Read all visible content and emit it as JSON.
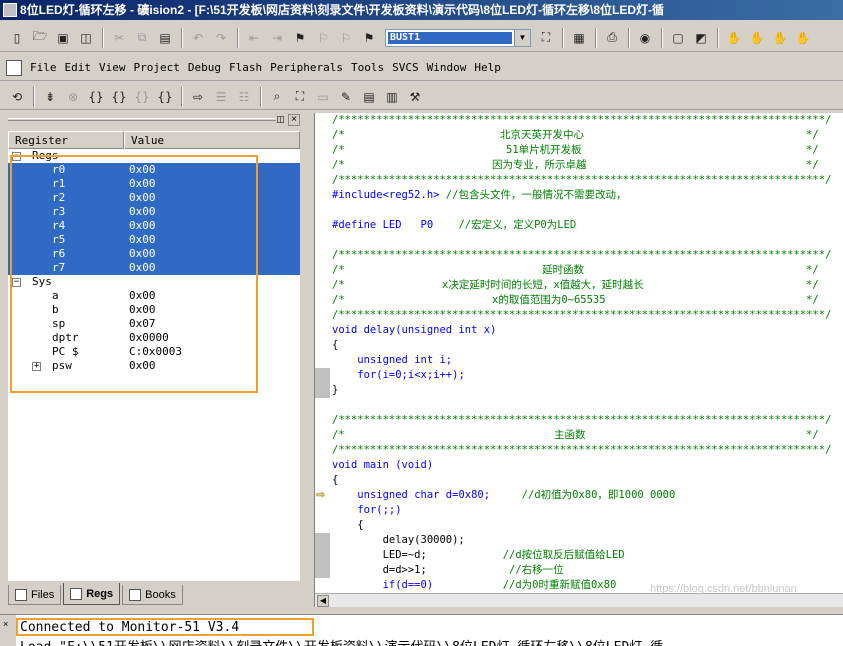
{
  "window": {
    "title": "8位LED灯-循环左移   - 礦ision2  - [F:\\51开发板\\网店资料\\刻录文件\\开发板资料\\演示代码\\8位LED灯-循环左移\\8位LED灯-循"
  },
  "toolbar": {
    "target_combo": "BUST1"
  },
  "menu": {
    "items": [
      "File",
      "Edit",
      "View",
      "Project",
      "Debug",
      "Flash",
      "Peripherals",
      "Tools",
      "SVCS",
      "Window",
      "Help"
    ]
  },
  "registers": {
    "header": {
      "col1": "Register",
      "col2": "Value"
    },
    "regs_label": "Regs",
    "regs": [
      {
        "name": "r0",
        "value": "0x00"
      },
      {
        "name": "r1",
        "value": "0x00"
      },
      {
        "name": "r2",
        "value": "0x00"
      },
      {
        "name": "r3",
        "value": "0x00"
      },
      {
        "name": "r4",
        "value": "0x00"
      },
      {
        "name": "r5",
        "value": "0x00"
      },
      {
        "name": "r6",
        "value": "0x00"
      },
      {
        "name": "r7",
        "value": "0x00"
      }
    ],
    "sys_label": "Sys",
    "sys": [
      {
        "name": "a",
        "value": "0x00"
      },
      {
        "name": "b",
        "value": "0x00"
      },
      {
        "name": "sp",
        "value": "0x07"
      },
      {
        "name": "dptr",
        "value": "0x0000"
      },
      {
        "name": "PC  $",
        "value": "C:0x0003"
      },
      {
        "name": "psw",
        "value": "0x00"
      }
    ],
    "expand_plus": "+",
    "expand_minus": "−"
  },
  "tabs": {
    "files": "Files",
    "regs": "Regs",
    "books": "Books"
  },
  "code": {
    "stars": "/*****************************************************************************/",
    "header_lines": [
      "北京天英开发中心",
      "51单片机开发板",
      "因为专业，所示卓越"
    ],
    "include_code": "#include<reg52.h>",
    "include_comment": "//包含头文件，一般情况不需要改动，",
    "define_code": "#define LED   P0",
    "define_comment": "//宏定义，定义P0为LED",
    "delay_header": [
      "延时函数",
      "x决定延时时间的长短，x值越大，延时越长",
      "x的取值范围为0~65535"
    ],
    "delay_sig": "void delay(unsigned int x)",
    "brace_open": "{",
    "brace_close": "}",
    "delay_decl": "unsigned int i;",
    "delay_loop": "for(i=0;i<x;i++);",
    "main_header": "主函数",
    "main_sig": "void main (void)",
    "main_decl": "unsigned char d=0x80;",
    "main_decl_comment": "//d初值为0x80，即1000 0000",
    "for_loop": "for(;;)",
    "inner_brace": "{",
    "delay_call": "delay(30000);",
    "led_assign": "LED=~d;",
    "led_comment": "//d按位取反后赋值给LED",
    "shift": "d=d>>1;",
    "shift_comment": "//右移一位",
    "if_stmt": "if(d==0)",
    "if_comment": "//d为0时重新赋值0x80",
    "comment_open": "/*",
    "comment_close": "*/"
  },
  "watermark": "https://blog.csdn.net/bbnlunan",
  "output": {
    "line1": "Connected to Monitor-51 V3.4",
    "line2": "Load \"F:\\\\51开发板\\\\网店资料\\\\刻录文件\\\\开发板资料\\\\演示代码\\\\8位LED灯-循环左移\\\\8位LED灯-循"
  }
}
